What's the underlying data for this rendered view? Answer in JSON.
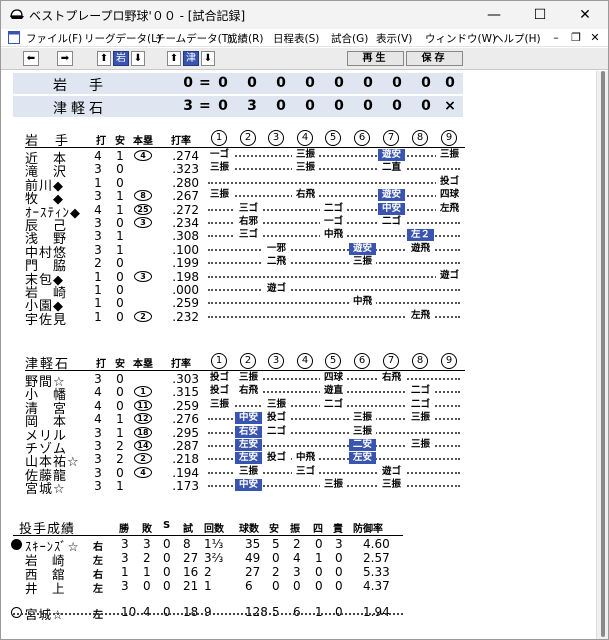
{
  "window": {
    "title": "ベストプレープロ野球'００ - [試合記録]"
  },
  "menu": {
    "items": [
      "ファイル(F)",
      "リーグデータ(L)",
      "チームデータ(T)",
      "成績(R)",
      "日程表(S)",
      "試合(G)",
      "表示(V)",
      "ウィンドウ(W)",
      "ヘルプ(H)"
    ]
  },
  "toolbar": {
    "team1": "岩",
    "team2": "津",
    "replay": "再生",
    "save": "保存"
  },
  "linescore": {
    "rows": [
      {
        "team": "岩　手",
        "total": "0",
        "innings": [
          "0",
          "0",
          "0",
          "0",
          "0",
          "0",
          "0",
          "0",
          "0"
        ]
      },
      {
        "team": "津軽石",
        "total": "3",
        "innings": [
          "0",
          "3",
          "0",
          "0",
          "0",
          "0",
          "0",
          "0",
          "×"
        ]
      }
    ]
  },
  "batting_headers": {
    "ab": "打",
    "h": "安",
    "hr": "本塁",
    "avg": "打率",
    "innings": [
      "1",
      "2",
      "3",
      "4",
      "5",
      "6",
      "7",
      "8",
      "9"
    ]
  },
  "batting": [
    {
      "team": "岩　手",
      "players": [
        {
          "name": "近　本",
          "ab": "4",
          "h": "1",
          "hr": "4",
          "avg": ".274",
          "res": [
            [
              "1",
              "一ゴ",
              0
            ],
            [
              "4",
              "三振",
              0
            ],
            [
              "7",
              "遊安",
              1
            ],
            [
              "9",
              "三振",
              0
            ]
          ]
        },
        {
          "name": "滝　沢",
          "ab": "3",
          "h": "0",
          "hr": "",
          "avg": ".323",
          "res": [
            [
              "1",
              "三振",
              0
            ],
            [
              "4",
              "三振",
              0
            ],
            [
              "7",
              "二直",
              0
            ]
          ]
        },
        {
          "name": "前川◆",
          "ab": "1",
          "h": "0",
          "hr": "",
          "avg": ".280",
          "res": [
            [
              "9",
              "投ゴ",
              0
            ]
          ]
        },
        {
          "name": "牧　◆",
          "ab": "3",
          "h": "1",
          "hr": "8",
          "avg": ".267",
          "res": [
            [
              "1",
              "三振",
              0
            ],
            [
              "4",
              "右飛",
              0
            ],
            [
              "7",
              "遊安",
              1
            ],
            [
              "9",
              "四球",
              0
            ]
          ]
        },
        {
          "name": "ｵｰｽﾃｨﾝ◆",
          "ab": "4",
          "h": "1",
          "hr": "25",
          "avg": ".272",
          "res": [
            [
              "2",
              "三ゴ",
              0
            ],
            [
              "5",
              "二ゴ",
              0
            ],
            [
              "7",
              "中安",
              1
            ],
            [
              "9",
              "左飛",
              0
            ]
          ]
        },
        {
          "name": "辰　己",
          "ab": "3",
          "h": "0",
          "hr": "3",
          "avg": ".234",
          "res": [
            [
              "2",
              "右邪",
              0
            ],
            [
              "5",
              "一ゴ",
              0
            ],
            [
              "7",
              "二ゴ",
              0
            ]
          ]
        },
        {
          "name": "浅　野",
          "ab": "3",
          "h": "1",
          "hr": "",
          "avg": ".308",
          "res": [
            [
              "2",
              "三ゴ",
              0
            ],
            [
              "5",
              "中飛",
              0
            ],
            [
              "8",
              "左２",
              1
            ]
          ]
        },
        {
          "name": "中村悠",
          "ab": "3",
          "h": "1",
          "hr": "",
          "avg": ".100",
          "res": [
            [
              "3",
              "一邪",
              0
            ],
            [
              "6",
              "遊安",
              1
            ],
            [
              "8",
              "遊飛",
              0
            ]
          ]
        },
        {
          "name": "門　脇",
          "ab": "2",
          "h": "0",
          "hr": "",
          "avg": ".199",
          "res": [
            [
              "3",
              "二飛",
              0
            ],
            [
              "6",
              "三振",
              0
            ]
          ]
        },
        {
          "name": "末包◆",
          "ab": "1",
          "h": "0",
          "hr": "3",
          "avg": ".198",
          "res": [
            [
              "9",
              "遊ゴ",
              0
            ]
          ]
        },
        {
          "name": "岩　崎",
          "ab": "1",
          "h": "0",
          "hr": "",
          "avg": ".000",
          "res": [
            [
              "3",
              "遊ゴ",
              0
            ]
          ]
        },
        {
          "name": "小園◆",
          "ab": "1",
          "h": "0",
          "hr": "",
          "avg": ".259",
          "res": [
            [
              "6",
              "中飛",
              0
            ]
          ]
        },
        {
          "name": "宇佐見",
          "ab": "1",
          "h": "0",
          "hr": "2",
          "avg": ".232",
          "res": [
            [
              "8",
              "左飛",
              0
            ]
          ]
        }
      ]
    },
    {
      "team": "津軽石",
      "players": [
        {
          "name": "野間☆",
          "ab": "3",
          "h": "0",
          "hr": "",
          "avg": ".303",
          "res": [
            [
              "1",
              "投ゴ",
              0
            ],
            [
              "2",
              "三振",
              0
            ],
            [
              "5",
              "四球",
              0
            ],
            [
              "7",
              "右飛",
              0
            ]
          ]
        },
        {
          "name": "小　幡",
          "ab": "4",
          "h": "0",
          "hr": "1",
          "avg": ".315",
          "res": [
            [
              "1",
              "投ゴ",
              0
            ],
            [
              "2",
              "右飛",
              0
            ],
            [
              "5",
              "遊直",
              0
            ],
            [
              "8",
              "二ゴ",
              0
            ]
          ]
        },
        {
          "name": "清　宮",
          "ab": "4",
          "h": "0",
          "hr": "11",
          "avg": ".259",
          "res": [
            [
              "1",
              "三振",
              0
            ],
            [
              "3",
              "三振",
              0
            ],
            [
              "5",
              "二ゴ",
              0
            ],
            [
              "8",
              "二ゴ",
              0
            ]
          ]
        },
        {
          "name": "岡　本",
          "ab": "4",
          "h": "1",
          "hr": "12",
          "avg": ".276",
          "res": [
            [
              "2",
              "中安",
              1
            ],
            [
              "3",
              "投ゴ",
              0
            ],
            [
              "6",
              "三振",
              0
            ],
            [
              "8",
              "三振",
              0
            ]
          ]
        },
        {
          "name": "メリル",
          "ab": "3",
          "h": "1",
          "hr": "18",
          "avg": ".295",
          "res": [
            [
              "2",
              "右安",
              1
            ],
            [
              "3",
              "二ゴ",
              0
            ],
            [
              "6",
              "三振",
              0
            ]
          ]
        },
        {
          "name": "チゾム",
          "ab": "3",
          "h": "2",
          "hr": "14",
          "avg": ".287",
          "res": [
            [
              "2",
              "左安",
              1
            ],
            [
              "6",
              "二安",
              1
            ],
            [
              "8",
              "三振",
              0
            ]
          ]
        },
        {
          "name": "山本祐☆",
          "ab": "3",
          "h": "2",
          "hr": "2",
          "avg": ".218",
          "res": [
            [
              "2",
              "左安",
              1
            ],
            [
              "3",
              "投ゴ",
              0
            ],
            [
              "4",
              "中飛",
              0
            ],
            [
              "6",
              "左安",
              1
            ]
          ]
        },
        {
          "name": "佐藤龍",
          "ab": "3",
          "h": "0",
          "hr": "4",
          "avg": ".194",
          "res": [
            [
              "2",
              "三振",
              0
            ],
            [
              "4",
              "三ゴ",
              0
            ],
            [
              "7",
              "遊ゴ",
              0
            ]
          ]
        },
        {
          "name": "宮城☆",
          "ab": "3",
          "h": "1",
          "hr": "",
          "avg": ".173",
          "res": [
            [
              "2",
              "中安",
              1
            ],
            [
              "5",
              "三振",
              0
            ],
            [
              "7",
              "三振",
              0
            ]
          ]
        }
      ]
    }
  ],
  "pitching": {
    "title": "投手成績",
    "headers": [
      "勝",
      "敗",
      "S",
      "試",
      "回数",
      "球数",
      "安",
      "振",
      "四",
      "責",
      "防御率"
    ],
    "pitchers": [
      {
        "mark": "●",
        "name": "ｽｷｰﾝｽﾞ☆",
        "hand": "右",
        "w": "3",
        "l": "3",
        "s": "0",
        "g": "8",
        "ip": "1⅓",
        "np": "35",
        "h": "5",
        "k": "2",
        "bb": "0",
        "er": "3",
        "era": "4.60"
      },
      {
        "mark": "",
        "name": "岩　崎",
        "hand": "左",
        "w": "3",
        "l": "2",
        "s": "0",
        "g": "27",
        "ip": "3⅔",
        "np": "49",
        "h": "0",
        "k": "4",
        "bb": "1",
        "er": "0",
        "era": "2.57"
      },
      {
        "mark": "",
        "name": "西　舘",
        "hand": "右",
        "w": "1",
        "l": "1",
        "s": "0",
        "g": "16",
        "ip": "2",
        "np": "27",
        "h": "2",
        "k": "3",
        "bb": "0",
        "er": "0",
        "era": "5.33"
      },
      {
        "mark": "",
        "name": "井　上",
        "hand": "左",
        "w": "3",
        "l": "0",
        "s": "0",
        "g": "21",
        "ip": "1",
        "np": "6",
        "h": "0",
        "k": "0",
        "bb": "0",
        "er": "0",
        "era": "4.37"
      },
      {
        "mark": "○",
        "name": "宮城☆",
        "hand": "左",
        "w": "10",
        "l": "4",
        "s": "0",
        "g": "18",
        "ip": "9",
        "np": "128",
        "h": "5",
        "k": "6",
        "bb": "1",
        "er": "0",
        "era": "1.94"
      }
    ]
  },
  "colors": {
    "hit": "#3a55b0",
    "linescore_bg": "#dfe6f2"
  }
}
